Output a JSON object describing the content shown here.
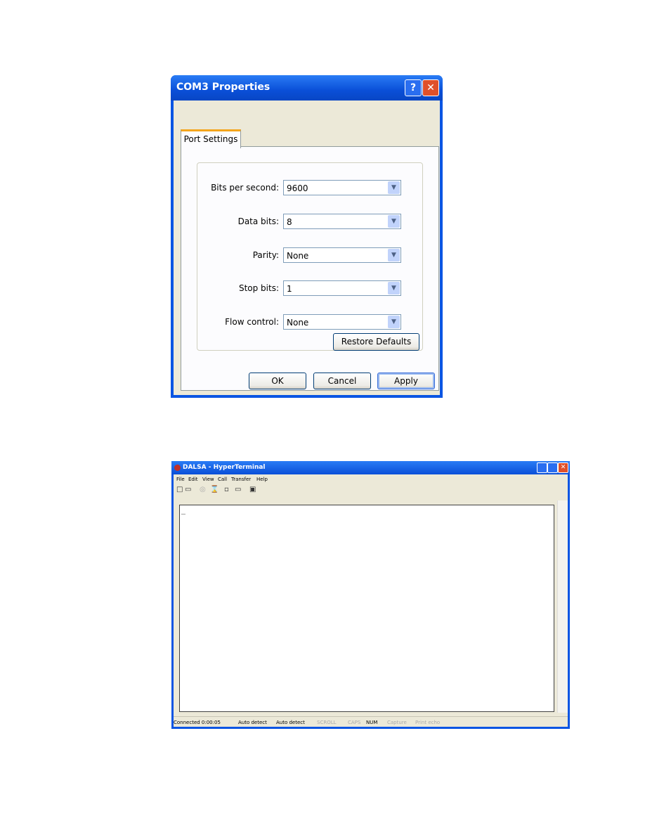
{
  "com3": {
    "title": "COM3 Properties",
    "help": "?",
    "close": "✕",
    "tab": "Port Settings",
    "fields": [
      {
        "label": "Bits per second:",
        "value": "9600"
      },
      {
        "label": "Data bits:",
        "value": "8"
      },
      {
        "label": "Parity:",
        "value": "None"
      },
      {
        "label": "Stop bits:",
        "value": "1"
      },
      {
        "label": "Flow control:",
        "value": "None"
      }
    ],
    "restore": "Restore Defaults",
    "ok": "OK",
    "cancel": "Cancel",
    "apply": "Apply"
  },
  "ht": {
    "title": "DALSA - HyperTerminal",
    "menu": [
      "File",
      "Edit",
      "View",
      "Call",
      "Transfer",
      "Help"
    ],
    "cursor": "_",
    "status": [
      "Connected 0:00:05",
      "Auto detect",
      "Auto detect",
      "SCROLL",
      "CAPS",
      "NUM",
      "Capture",
      "Print echo"
    ],
    "toolbar_icons": [
      "new-icon",
      "open-icon",
      "connect-icon",
      "disconnect-icon",
      "send-icon",
      "receive-icon",
      "properties-icon"
    ]
  }
}
